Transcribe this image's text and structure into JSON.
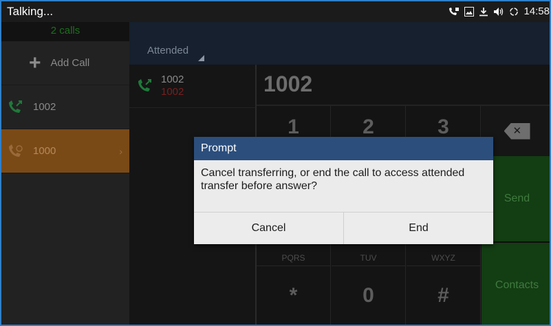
{
  "statusbar": {
    "title": "Talking...",
    "time": "14:58",
    "icons": [
      "call-status-icon",
      "image-icon",
      "download-icon",
      "volume-icon",
      "sync-icon"
    ]
  },
  "left": {
    "calls_count": "2 calls",
    "add_call_label": "Add Call",
    "calls": [
      {
        "number": "1002",
        "active": false
      },
      {
        "number": "1000",
        "active": true
      }
    ]
  },
  "center": {
    "transfer_mode": "Attended",
    "entry_number": "1002",
    "entry_name": "1002"
  },
  "dialpad": {
    "display": "1002",
    "keys": [
      {
        "digit": "1",
        "letters": ""
      },
      {
        "digit": "2",
        "letters": ""
      },
      {
        "digit": "3",
        "letters": ""
      },
      {
        "digit": "",
        "letters": "PQRS"
      },
      {
        "digit": "",
        "letters": "TUV"
      },
      {
        "digit": "",
        "letters": "WXYZ"
      },
      {
        "digit": "*",
        "letters": ""
      },
      {
        "digit": "0",
        "letters": ""
      },
      {
        "digit": "#",
        "letters": ""
      }
    ],
    "send_label": "Send",
    "contacts_label": "Contacts"
  },
  "dialog": {
    "title": "Prompt",
    "message": "Cancel transferring, or end the call to access attended transfer before answer?",
    "cancel_label": "Cancel",
    "end_label": "End"
  },
  "colors": {
    "dialog_title_bg": "#2b4e7d",
    "active_call_bg": "#7a4a16",
    "send_bg": "#133d13"
  }
}
